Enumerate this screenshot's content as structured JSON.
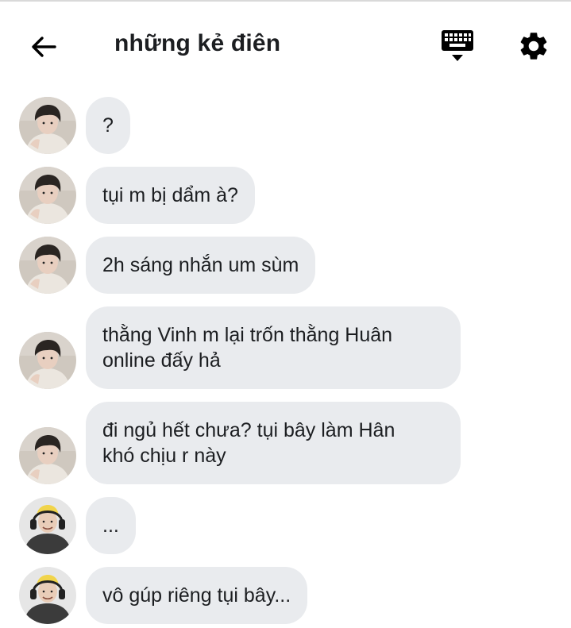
{
  "header": {
    "title": "những kẻ điên",
    "back_icon": "arrow-left-icon",
    "keyboard_icon": "keyboard-icon",
    "settings_icon": "gear-icon"
  },
  "colors": {
    "bubble_bg": "#e9ebee",
    "text": "#1c1e21",
    "icon": "#000000"
  },
  "messages": [
    {
      "sender": "user-a",
      "lines": [
        "?"
      ]
    },
    {
      "sender": "user-a",
      "lines": [
        "tụi m bị dẩm à?"
      ]
    },
    {
      "sender": "user-a",
      "lines": [
        "2h sáng nhắn um sùm"
      ]
    },
    {
      "sender": "user-a",
      "lines": [
        "thằng Vinh m lại trốn thằng Huân",
        "online đấy hả"
      ]
    },
    {
      "sender": "user-a",
      "lines": [
        "đi ngủ hết chưa? tụi bây làm Hân",
        "khó chịu r này"
      ]
    },
    {
      "sender": "user-b",
      "lines": [
        "..."
      ]
    },
    {
      "sender": "user-b",
      "lines": [
        "vô gúp riêng tụi bây..."
      ]
    }
  ]
}
